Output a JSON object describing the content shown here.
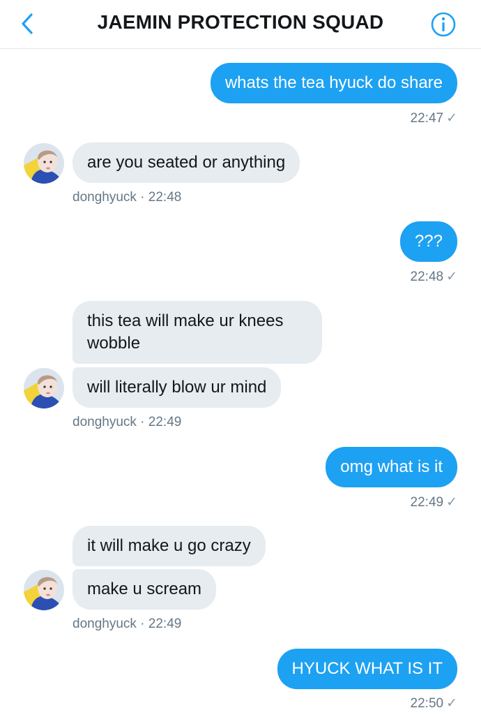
{
  "header": {
    "title": "JAEMIN PROTECTION SQUAD",
    "back_icon": "chevron-left-icon",
    "info_icon": "info-icon",
    "accent": "#1da1f2"
  },
  "messages": [
    {
      "direction": "outgoing",
      "text": "whats the tea hyuck do share",
      "time": "22:47",
      "status": "✓"
    },
    {
      "direction": "incoming",
      "texts": [
        "are you seated or anything"
      ],
      "sender": "donghyuck",
      "time": "22:48"
    },
    {
      "direction": "outgoing",
      "text": "???",
      "time": "22:48",
      "status": "✓"
    },
    {
      "direction": "incoming",
      "texts": [
        "this tea will make ur knees wobble",
        "will literally blow ur mind"
      ],
      "sender": "donghyuck",
      "time": "22:49"
    },
    {
      "direction": "outgoing",
      "text": "omg what is it",
      "time": "22:49",
      "status": "✓"
    },
    {
      "direction": "incoming",
      "texts": [
        "it will make u go crazy",
        "make u scream"
      ],
      "sender": "donghyuck",
      "time": "22:49"
    },
    {
      "direction": "outgoing",
      "text": "HYUCK WHAT IS IT",
      "time": "22:50",
      "status": "✓"
    }
  ],
  "meta_separator": " · ",
  "colors": {
    "outgoing_bubble": "#1da1f2",
    "incoming_bubble": "#e6ecf0",
    "meta_text": "#657786"
  }
}
